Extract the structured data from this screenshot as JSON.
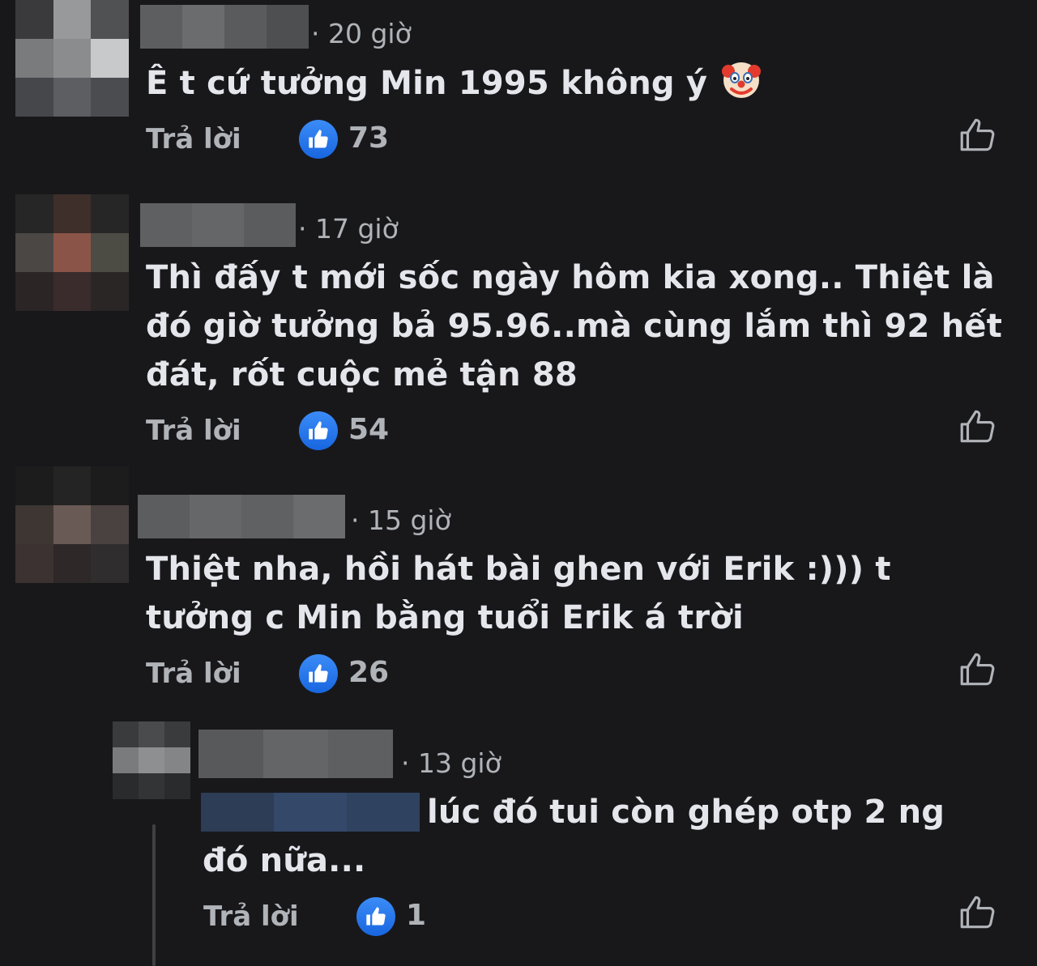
{
  "comments": [
    {
      "time": "· 20 giờ",
      "text": "Ê t cứ tưởng Min 1995 không ý",
      "emoji": "clown-face-icon",
      "reply_label": "Trả lời",
      "likes": "73"
    },
    {
      "time": "· 17 giờ",
      "text": "Thì đấy t mới sốc ngày hôm kia xong.. Thiệt là đó giờ tưởng bả 95.96..mà cùng lắm thì 92 hết đát, rốt cuộc mẻ tận 88",
      "reply_label": "Trả lời",
      "likes": "54"
    },
    {
      "time": "· 15 giờ",
      "text": "Thiệt nha, hồi hát bài ghen với Erik :))) t tưởng c Min bằng tuổi Erik á trời",
      "reply_label": "Trả lời",
      "likes": "26"
    },
    {
      "time": "· 13 giờ",
      "text": "lúc đó tui còn ghép otp 2 ng đó nữa...",
      "reply_label": "Trả lời",
      "likes": "1"
    }
  ],
  "colors": {
    "background": "#18181b",
    "text": "#e4e6eb",
    "muted": "#b0b3b8",
    "like_blue": "#1877f2"
  }
}
